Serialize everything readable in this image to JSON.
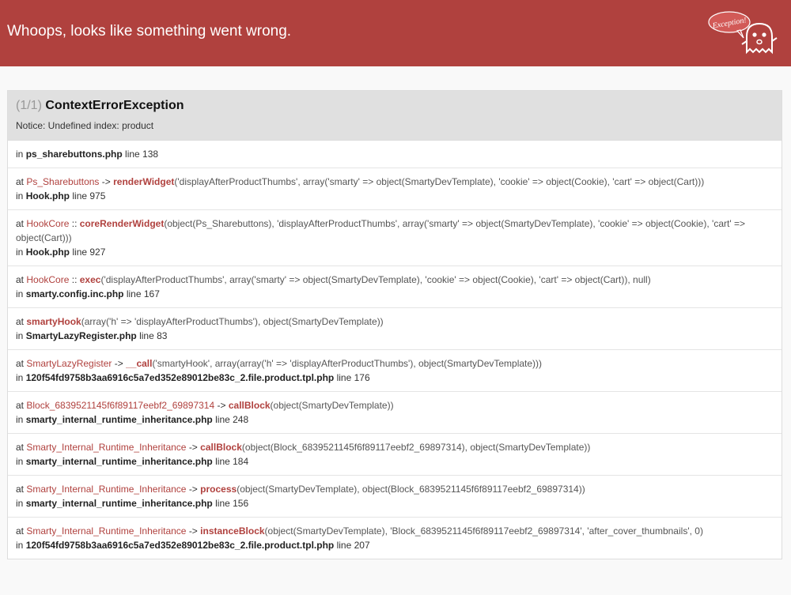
{
  "header": {
    "title": "Whoops, looks like something went wrong.",
    "ghost_bubble_text": "Exception!",
    "color": "#b0413e"
  },
  "exception": {
    "count": "(1/1)",
    "name": "ContextErrorException",
    "message": "Notice: Undefined index: product"
  },
  "traces": [
    {
      "at": "",
      "cls": "",
      "sep": "",
      "fn": "",
      "args": "",
      "in": "in",
      "file": "ps_sharebuttons.php",
      "line": "line 138"
    },
    {
      "at": "at",
      "cls": "Ps_Sharebuttons",
      "sep": "->",
      "fn": "renderWidget",
      "args": "('displayAfterProductThumbs', array('smarty' => object(SmartyDevTemplate), 'cookie' => object(Cookie), 'cart' => object(Cart)))",
      "in": "in",
      "file": "Hook.php",
      "line": "line 975"
    },
    {
      "at": "at",
      "cls": "HookCore",
      "sep": "::",
      "fn": "coreRenderWidget",
      "args": "(object(Ps_Sharebuttons), 'displayAfterProductThumbs', array('smarty' => object(SmartyDevTemplate), 'cookie' => object(Cookie), 'cart' => object(Cart)))",
      "in": "in",
      "file": "Hook.php",
      "line": "line 927"
    },
    {
      "at": "at",
      "cls": "HookCore",
      "sep": "::",
      "fn": "exec",
      "args": "('displayAfterProductThumbs', array('smarty' => object(SmartyDevTemplate), 'cookie' => object(Cookie), 'cart' => object(Cart)), null)",
      "in": "in",
      "file": "smarty.config.inc.php",
      "line": "line 167"
    },
    {
      "at": "at",
      "cls": "",
      "sep": "",
      "fn": "smartyHook",
      "args": "(array('h' => 'displayAfterProductThumbs'), object(SmartyDevTemplate))",
      "in": "in",
      "file": "SmartyLazyRegister.php",
      "line": "line 83"
    },
    {
      "at": "at",
      "cls": "SmartyLazyRegister",
      "sep": "->",
      "fn": "__call",
      "args": "('smartyHook', array(array('h' => 'displayAfterProductThumbs'), object(SmartyDevTemplate)))",
      "in": "in",
      "file": "120f54fd9758b3aa6916c5a7ed352e89012be83c_2.file.product.tpl.php",
      "line": "line 176"
    },
    {
      "at": "at",
      "cls": "Block_6839521145f6f89117eebf2_69897314",
      "sep": "->",
      "fn": "callBlock",
      "args": "(object(SmartyDevTemplate))",
      "in": "in",
      "file": "smarty_internal_runtime_inheritance.php",
      "line": "line 248"
    },
    {
      "at": "at",
      "cls": "Smarty_Internal_Runtime_Inheritance",
      "sep": "->",
      "fn": "callBlock",
      "args": "(object(Block_6839521145f6f89117eebf2_69897314), object(SmartyDevTemplate))",
      "in": "in",
      "file": "smarty_internal_runtime_inheritance.php",
      "line": "line 184"
    },
    {
      "at": "at",
      "cls": "Smarty_Internal_Runtime_Inheritance",
      "sep": "->",
      "fn": "process",
      "args": "(object(SmartyDevTemplate), object(Block_6839521145f6f89117eebf2_69897314))",
      "in": "in",
      "file": "smarty_internal_runtime_inheritance.php",
      "line": "line 156"
    },
    {
      "at": "at",
      "cls": "Smarty_Internal_Runtime_Inheritance",
      "sep": "->",
      "fn": "instanceBlock",
      "args": "(object(SmartyDevTemplate), 'Block_6839521145f6f89117eebf2_69897314', 'after_cover_thumbnails', 0)",
      "in": "in",
      "file": "120f54fd9758b3aa6916c5a7ed352e89012be83c_2.file.product.tpl.php",
      "line": "line 207"
    }
  ]
}
